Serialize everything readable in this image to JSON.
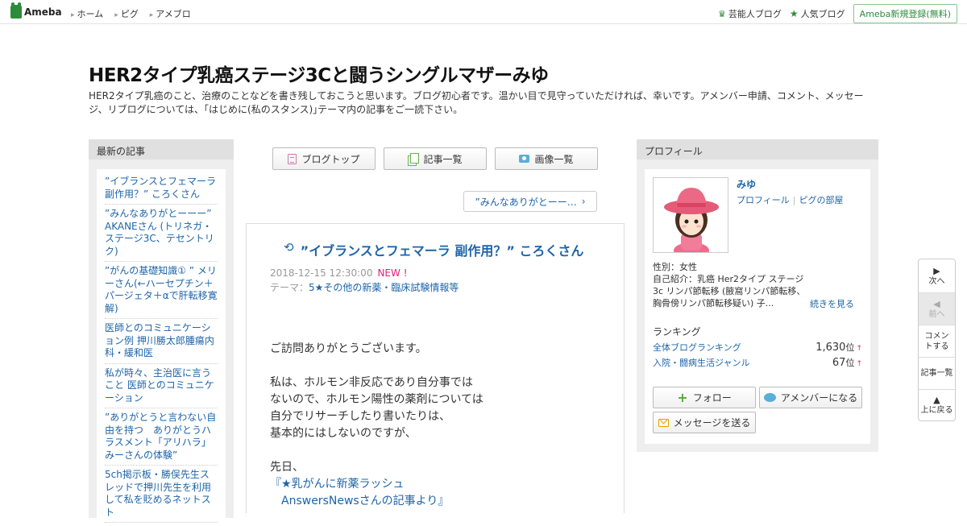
{
  "topbar": {
    "logo": "Ameba",
    "nav": [
      "ホーム",
      "ピグ",
      "アメブロ"
    ],
    "links": [
      {
        "label": "芸能人ブログ",
        "icon": "crown-icon"
      },
      {
        "label": "人気ブログ",
        "icon": "star-icon"
      }
    ],
    "register": "Ameba新規登録(無料)"
  },
  "header": {
    "title": "HER2タイプ乳癌ステージ3Cと闘うシングルマザーみゆ",
    "description": "HER2タイプ乳癌のこと、治療のことなどを書き残しておこうと思います。ブログ初心者です。温かい目で見守っていただければ、幸いです。アメンバー申請、コメント、メッセージ、リブログについては、｢はじめに(私のスタンス)｣テーマ内の記事をご一読下さい。"
  },
  "left": {
    "heading": "最新の記事",
    "items": [
      "”イブランスとフェマーラ 副作用？” ころくさん",
      "”みんなありがとーーー” AKANEさん (トリネガ・ステージ3C、テセントリク)",
      "”がんの基礎知識① ” メリーさん(←ハーセプチン＋パージェタ＋αで肝転移寛解)",
      "医師とのコミュニケーション例 押川勝太郎腫瘍内科・緩和医",
      "私が時々、主治医に言うこと 医師とのコミュニケーション",
      "”ありがとうと言わない自由を持つ　ありがとうハラスメント「アリハラ」　みーさんの体験”",
      "5ch掲示板・勝俣先生スレッドで押川先生を利用して私を貶めるネットスト"
    ]
  },
  "center": {
    "buttons": [
      "ブログトップ",
      "記事一覧",
      "画像一覧"
    ],
    "next_link": "”みんなありがとーー…",
    "article": {
      "title": "”イブランスとフェマーラ 副作用？” ころくさん",
      "date": "2018-12-15 12:30:00",
      "new": "NEW !",
      "theme_label": "テーマ：",
      "theme": "5★その他の新薬・臨床試験情報等",
      "lines": [
        "ご訪問ありがとうございます。",
        "",
        "私は、ホルモン非反応であり自分事では",
        "ないので、ホルモン陽性の薬剤については",
        "自分でリサーチしたり書いたりは、",
        "基本的にはしないのですが、",
        "",
        "先日、"
      ],
      "link1": "『★乳がんに新薬ラッシュ",
      "link2": "　AnswersNewsさんの記事より』"
    }
  },
  "right": {
    "heading": "プロフィール",
    "name": "みゆ",
    "link_profile": "プロフィール",
    "link_pig": "ピグの部屋",
    "gender": "性別：女性",
    "intro": "自己紹介：乳癌 Her2タイプ ステージ3c リンパ節転移 (腋窩リンパ節転移、胸骨傍リンパ節転移疑い) 子...",
    "more": "続きを見る",
    "ranking_heading": "ランキング",
    "rank_overall_label": "全体ブログランキング",
    "rank_overall_value": "1,630",
    "rank_genre_label": "入院・闘病生活ジャンル",
    "rank_genre_value": "67",
    "rank_unit": "位",
    "follow": "フォロー",
    "amember": "アメンバーになる",
    "message": "メッセージを送る"
  },
  "floatnav": {
    "next": "次へ",
    "prev": "前へ",
    "comment": "コメントする",
    "list": "記事一覧",
    "top": "上に戻る"
  },
  "colors": {
    "accent": "#2d8c3c",
    "link": "#1e64aa",
    "new": "#e0207a"
  }
}
